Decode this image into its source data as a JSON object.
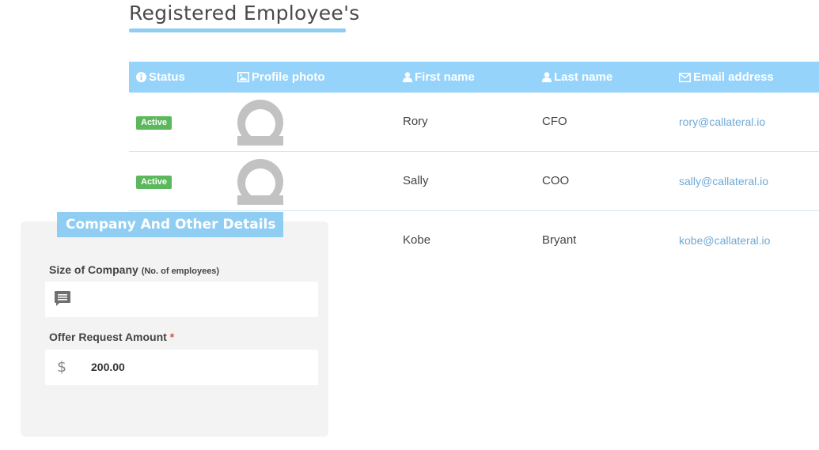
{
  "page": {
    "title": "Registered Employee's"
  },
  "table": {
    "columns": [
      {
        "key": "status",
        "label": "Status",
        "icon": "info-circle-icon"
      },
      {
        "key": "photo",
        "label": "Profile photo",
        "icon": "image-icon"
      },
      {
        "key": "first_name",
        "label": "First name",
        "icon": "user-icon"
      },
      {
        "key": "last_name",
        "label": "Last name",
        "icon": "user-icon"
      },
      {
        "key": "email",
        "label": "Email address",
        "icon": "envelope-icon"
      }
    ],
    "rows": [
      {
        "status": "Active",
        "first_name": "Rory",
        "last_name": "CFO",
        "email": "rory@callateral.io"
      },
      {
        "status": "Active",
        "first_name": "Sally",
        "last_name": "COO",
        "email": "sally@callateral.io"
      },
      {
        "status": "",
        "first_name": "Kobe",
        "last_name": "Bryant",
        "email": "kobe@callateral.io"
      }
    ]
  },
  "details": {
    "title": "Company And Other Details",
    "size_label": "Size of Company",
    "size_hint": "(No. of employees)",
    "size_value": "",
    "offer_label": "Offer Request Amount",
    "offer_required": "*",
    "offer_value": "200.00",
    "currency_symbol": "$"
  },
  "colors": {
    "accent": "#96d3fb",
    "active_badge": "#5cb85c",
    "email_link": "#6fa9d6"
  }
}
